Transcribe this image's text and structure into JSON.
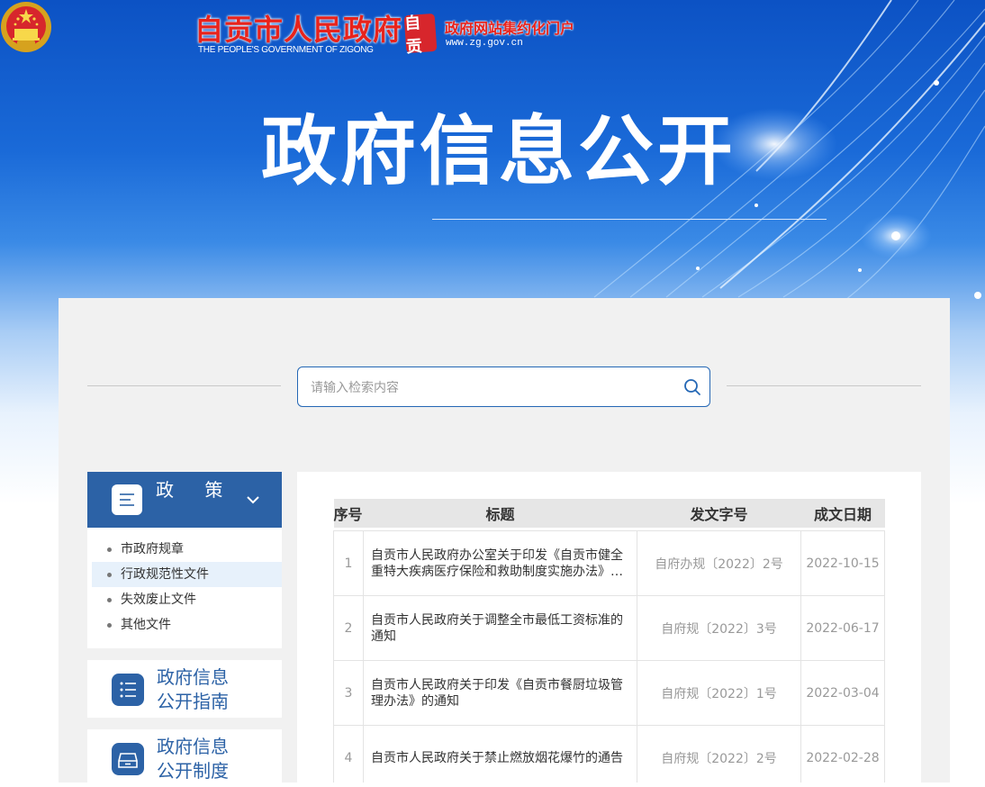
{
  "header": {
    "site_name": "自贡市人民政府",
    "site_name_en": "THE PEOPLE'S GOVERNMENT OF ZIGONG",
    "badge_text": "自贡",
    "portal_name": "政府网站集约化门户",
    "portal_url": "www.zg.gov.cn",
    "page_title": "政府信息公开"
  },
  "search": {
    "placeholder": "请输入检索内容",
    "value": ""
  },
  "sidebar": {
    "section_title": "政 策",
    "items": [
      {
        "label": "市政府规章"
      },
      {
        "label": "行政规范性文件"
      },
      {
        "label": "失效废止文件"
      },
      {
        "label": "其他文件"
      }
    ],
    "active_index": 1,
    "cards": [
      {
        "line1": "政府信息",
        "line2": "公开指南",
        "icon": "list-icon"
      },
      {
        "line1": "政府信息",
        "line2": "公开制度",
        "icon": "archive-box-icon"
      }
    ]
  },
  "table": {
    "headers": [
      "序号",
      "标题",
      "发文字号",
      "成文日期"
    ],
    "rows": [
      {
        "no": "1",
        "title": "自贡市人民政府办公室关于印发《自贡市健全重特大疾病医疗保险和救助制度实施办法》…",
        "doc_no": "自府办规〔2022〕2号",
        "date": "2022-10-15"
      },
      {
        "no": "2",
        "title": "自贡市人民政府关于调整全市最低工资标准的通知",
        "doc_no": "自府规〔2022〕3号",
        "date": "2022-06-17"
      },
      {
        "no": "3",
        "title": "自贡市人民政府关于印发《自贡市餐厨垃圾管理办法》的通知",
        "doc_no": "自府规〔2022〕1号",
        "date": "2022-03-04"
      },
      {
        "no": "4",
        "title": "自贡市人民政府关于禁止燃放烟花爆竹的通告",
        "doc_no": "自府规〔2022〕2号",
        "date": "2022-02-28"
      }
    ]
  },
  "colors": {
    "brand_blue": "#2c62a6",
    "header_red": "#e8231c",
    "search_border": "#2467b5"
  }
}
